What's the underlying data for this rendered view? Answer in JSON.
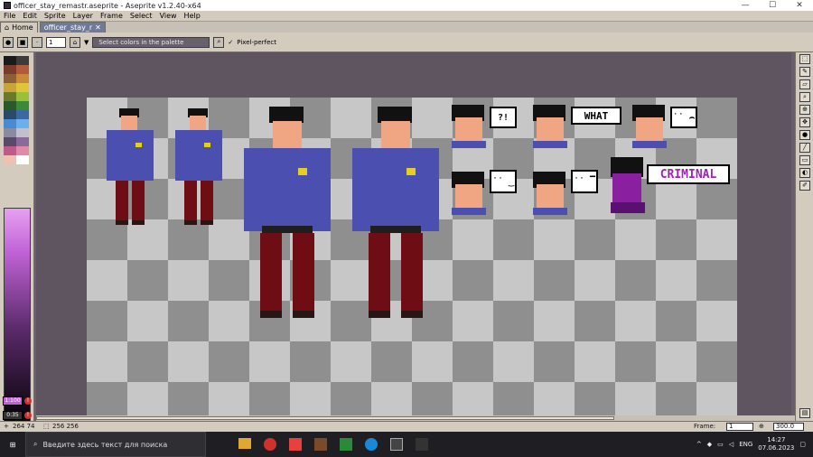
{
  "window": {
    "title": "officer_stay_remastr.aseprite - Aseprite v1.2.40-x64",
    "controls": [
      "—",
      "☐",
      "✕"
    ]
  },
  "menu": [
    "File",
    "Edit",
    "Sprite",
    "Layer",
    "Frame",
    "Select",
    "View",
    "Help"
  ],
  "tabs": [
    {
      "label": "Home",
      "icon": "home-icon"
    },
    {
      "label": "officer_stay_r",
      "icon": "sprite-icon",
      "close": "✕"
    }
  ],
  "toolbar": {
    "brush_size": "1",
    "hint": "Select colors in the palette",
    "pixel_perfect_label": "Pixel-perfect",
    "pixel_perfect_check": "✓"
  },
  "palette": {
    "colors": [
      "#1a1a1a",
      "#3b3b3b",
      "#7b3b2a",
      "#b35a3a",
      "#8a5f3a",
      "#c78a3a",
      "#c7a53a",
      "#e0c53a",
      "#6a7a2a",
      "#9ac03a",
      "#2a5a2a",
      "#3a8a3a",
      "#2a4a6a",
      "#3a6aa0",
      "#4a8ad0",
      "#6ab0f0",
      "#8a8aa0",
      "#c0c0d0",
      "#5a4a6a",
      "#8a6a9a",
      "#c05a8a",
      "#e08aa8",
      "#f0c0b0",
      "#ffffff"
    ],
    "fg_label": "1:100",
    "bg_label": "0:35",
    "alert": "!"
  },
  "canvas": {
    "bubbles": [
      "?!",
      "WHAT",
      "˙˙ ⌢",
      "˙˙ ‿",
      "˙˙ ▔",
      "CRIMINAL"
    ]
  },
  "status": {
    "coords": "264 74",
    "size": "256 256",
    "frame_label": "Frame:",
    "frame_value": "1",
    "zoom": "300.0"
  },
  "taskbar": {
    "search_placeholder": "Введите здесь текст для поиска",
    "lang": "ENG",
    "time": "14:27",
    "date": "07.06.2023"
  }
}
